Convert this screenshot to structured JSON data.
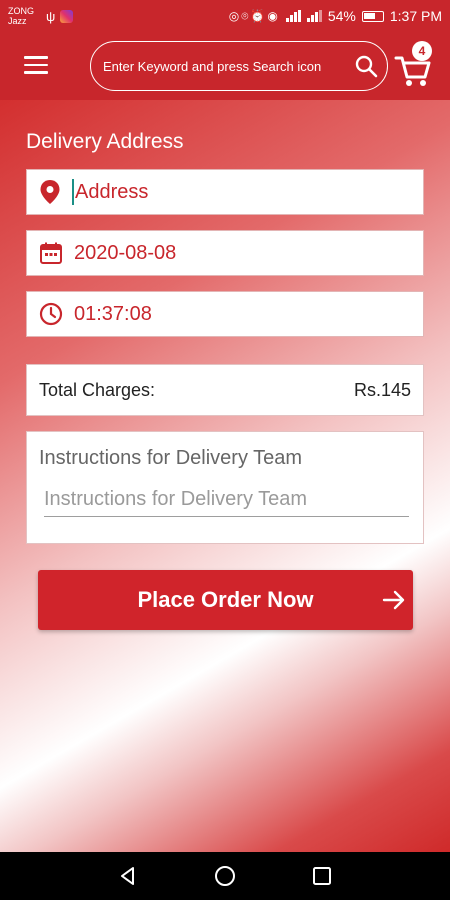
{
  "status_bar": {
    "carrier_line1": "ZONG",
    "carrier_line2": "Jazz",
    "battery": "54%",
    "time": "1:37 PM"
  },
  "header": {
    "search_placeholder": "Enter Keyword and press Search icon",
    "cart_count": "4",
    "icons": [
      "menu-icon",
      "search-icon",
      "cart-icon"
    ]
  },
  "delivery": {
    "title": "Delivery Address",
    "address_placeholder": "Address",
    "date": "2020-08-08",
    "time": "01:37:08"
  },
  "charges": {
    "label": "Total Charges:",
    "value": "Rs.145"
  },
  "instructions": {
    "title": "Instructions for Delivery Team",
    "placeholder": "Instructions for Delivery Team"
  },
  "actions": {
    "place_order_label": "Place Order Now"
  },
  "colors": {
    "brand": "#c8262c",
    "button": "#d0242b"
  }
}
